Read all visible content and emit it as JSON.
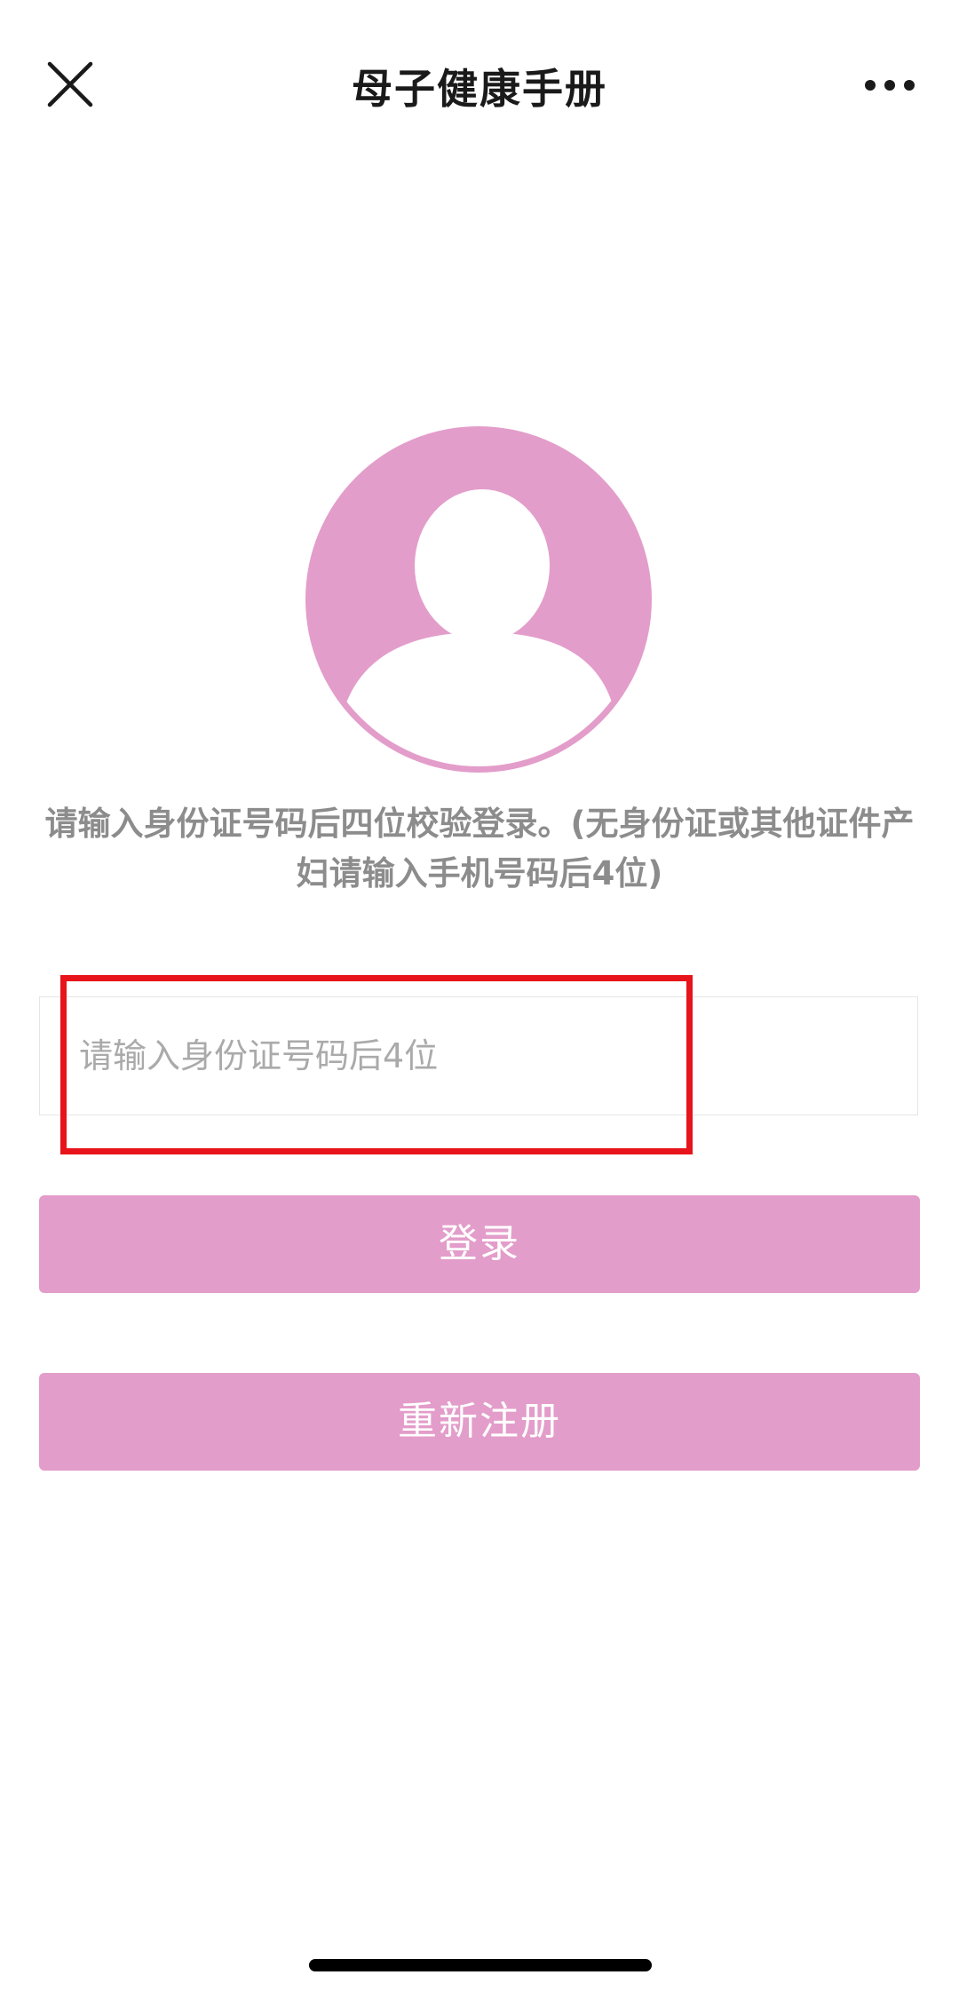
{
  "header": {
    "title": "母子健康手册",
    "close_icon": "close-icon",
    "more_icon": "more-dots-icon"
  },
  "avatar": {
    "icon": "user-avatar-icon",
    "color": "#e39dca"
  },
  "hint_text": "请输入身份证号码后四位校验登录。(无身份证或其他证件产妇请输入手机号码后4位)",
  "id_input": {
    "placeholder": "请输入身份证号码后4位",
    "value": ""
  },
  "buttons": {
    "login_label": "登录",
    "register_label": "重新注册"
  },
  "colors": {
    "accent": "#e39dca",
    "highlight": "#e8141b",
    "hint_text": "#8c8c8c"
  }
}
